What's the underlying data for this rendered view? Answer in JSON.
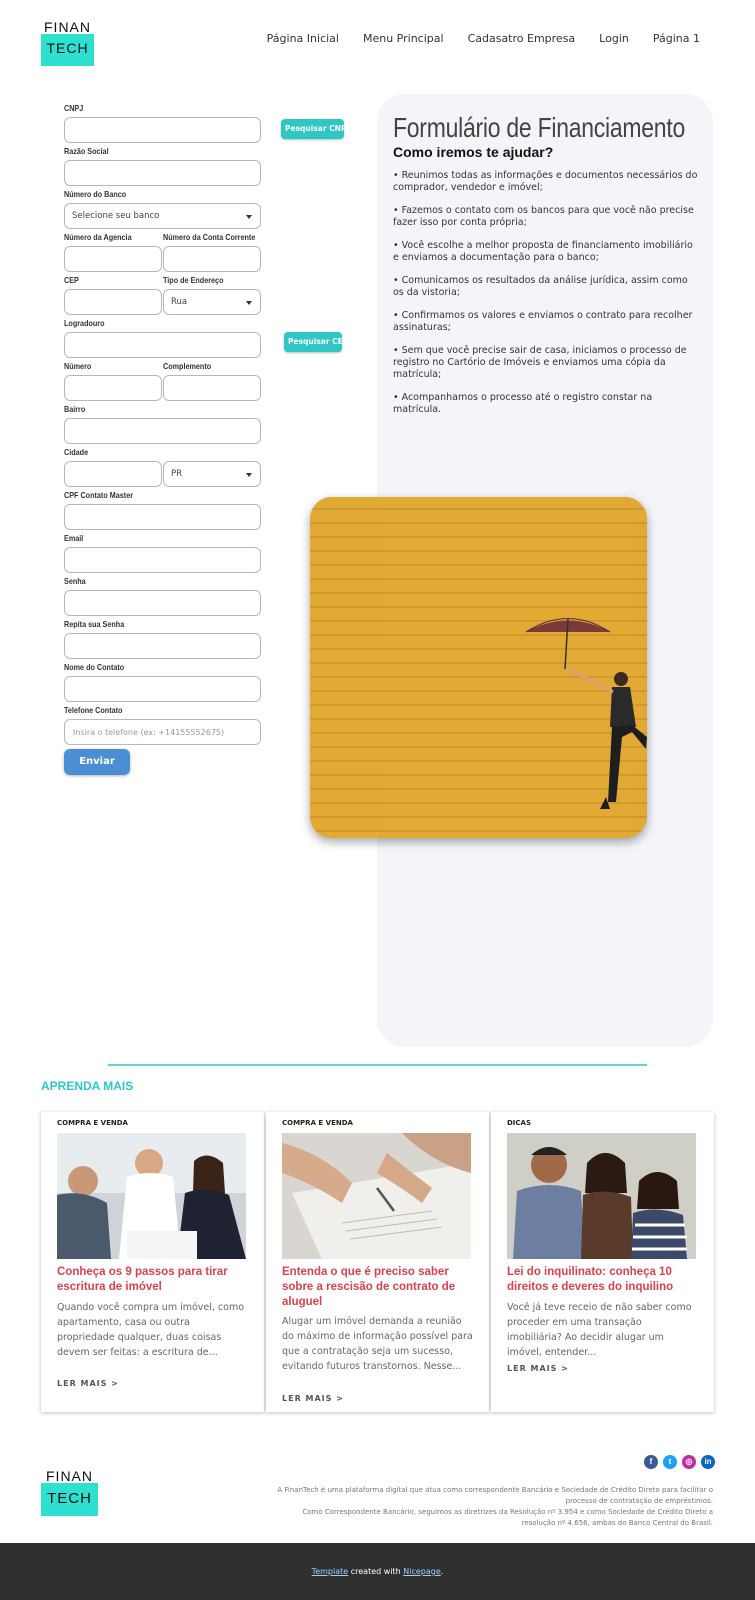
{
  "header": {
    "logo_top": "FINAN",
    "logo_bottom": "TECH",
    "nav": [
      "Página Inicial",
      "Menu Principal",
      "Cadasatro Empresa",
      "Login",
      "Página 1"
    ]
  },
  "form": {
    "labels": {
      "cnpj": "CNPJ",
      "razao": "Razão Social",
      "banco": "Número do Banco",
      "agencia": "Número da Agencia",
      "conta": "Número da Conta Corrente",
      "cep": "CEP",
      "tipo_endereco": "Tipo de Endereço",
      "logradouro": "Logradouro",
      "numero": "Número",
      "complemento": "Complemento",
      "bairro": "Bairro",
      "cidade": "Cidade",
      "cpf": "CPF Contato Master",
      "email": "Email",
      "senha": "Senha",
      "repita": "Repita sua Senha",
      "nome": "Nome do Contato",
      "telefone": "Telefone Contato"
    },
    "banco_select": "Selecione seu banco",
    "tipo_select": "Rua",
    "uf_select": "PR",
    "telefone_placeholder": "Insira o telefone (ex: +14155552675)",
    "btn_cnpj": "Pesquisar CNPJ",
    "btn_cep": "Pesquisar CEP",
    "submit": "Enviar"
  },
  "panel": {
    "title": "Formulário de Financiamento",
    "subtitle": "Como iremos te ajudar?",
    "bullets": [
      "• Reunimos todas as informações e documentos necessários do comprador, vendedor e imóvel;",
      "• Fazemos o contato com os bancos para que você não precise fazer isso por conta própria;",
      "• Você escolhe a melhor proposta de financiamento imobiliário e enviamos a documentação para o banco;",
      "• Comunicamos os resultados da análise jurídica, assim como os da vistoria;",
      "• Confirmamos os valores e enviamos o contrato para recolher assinaturas;",
      "• Sem que você precise sair de casa, iniciamos o processo de registro no Cartório de Imóveis e enviamos uma cópia da matrícula;",
      "• Acompanhamos o processo até o registro constar na matrícula."
    ]
  },
  "learn_more": {
    "heading": "APRENDA MAIS",
    "cards": [
      {
        "category": "COMPRA E VENDA",
        "title": "Conheça os 9 passos para tirar escritura de imóvel",
        "excerpt": "Quando você compra um imóvel, como apartamento, casa ou outra propriedade qualquer, duas coisas devem ser feitas: a escritura de...",
        "more": "LER MAIS >"
      },
      {
        "category": "COMPRA E VENDA",
        "title": "Entenda o que é preciso saber sobre a rescisão de contrato de aluguel",
        "excerpt": "Alugar um imóvel demanda a reunião do máximo de informação possível para que a contratação seja um sucesso, evitando futuros transtornos. Nesse...",
        "more": "LER MAIS >"
      },
      {
        "category": "DICAS",
        "title": "Lei do inquilinato: conheça 10 direitos e deveres do inquilino",
        "excerpt": "Você já teve receio de não saber como proceder em uma transação imobiliária? Ao decidir alugar um imóvel, entender...",
        "more": "LER MAIS >"
      }
    ]
  },
  "footer": {
    "logo_top": "FINAN",
    "logo_bottom": "TECH",
    "social": [
      "facebook-icon",
      "twitter-icon",
      "instagram-icon",
      "linkedin-icon"
    ],
    "disclaimer_1": "A FinanTech é uma plataforma digital que atua como correspondente Bancário e Sociedade de Crédito Direto para facilitar o processo de contratação de empréstimos.",
    "disclaimer_2": "Como Correspondente Bancário, seguimos as diretrizes da Resolução nº 3.954 e como Sociedade de Crédito Direto a resolução nº 4.656, ambas do Banco Central do Brasil.",
    "credit_link1": "Template",
    "credit_mid": " created with ",
    "credit_link2": "Nicepage",
    "credit_end": "."
  },
  "colors": {
    "accent": "#2ec7c4",
    "title_red": "#d9414f",
    "submit_blue": "#4a8fd4",
    "panel_bg": "#f3f5f9",
    "footer_bar": "#303030"
  }
}
